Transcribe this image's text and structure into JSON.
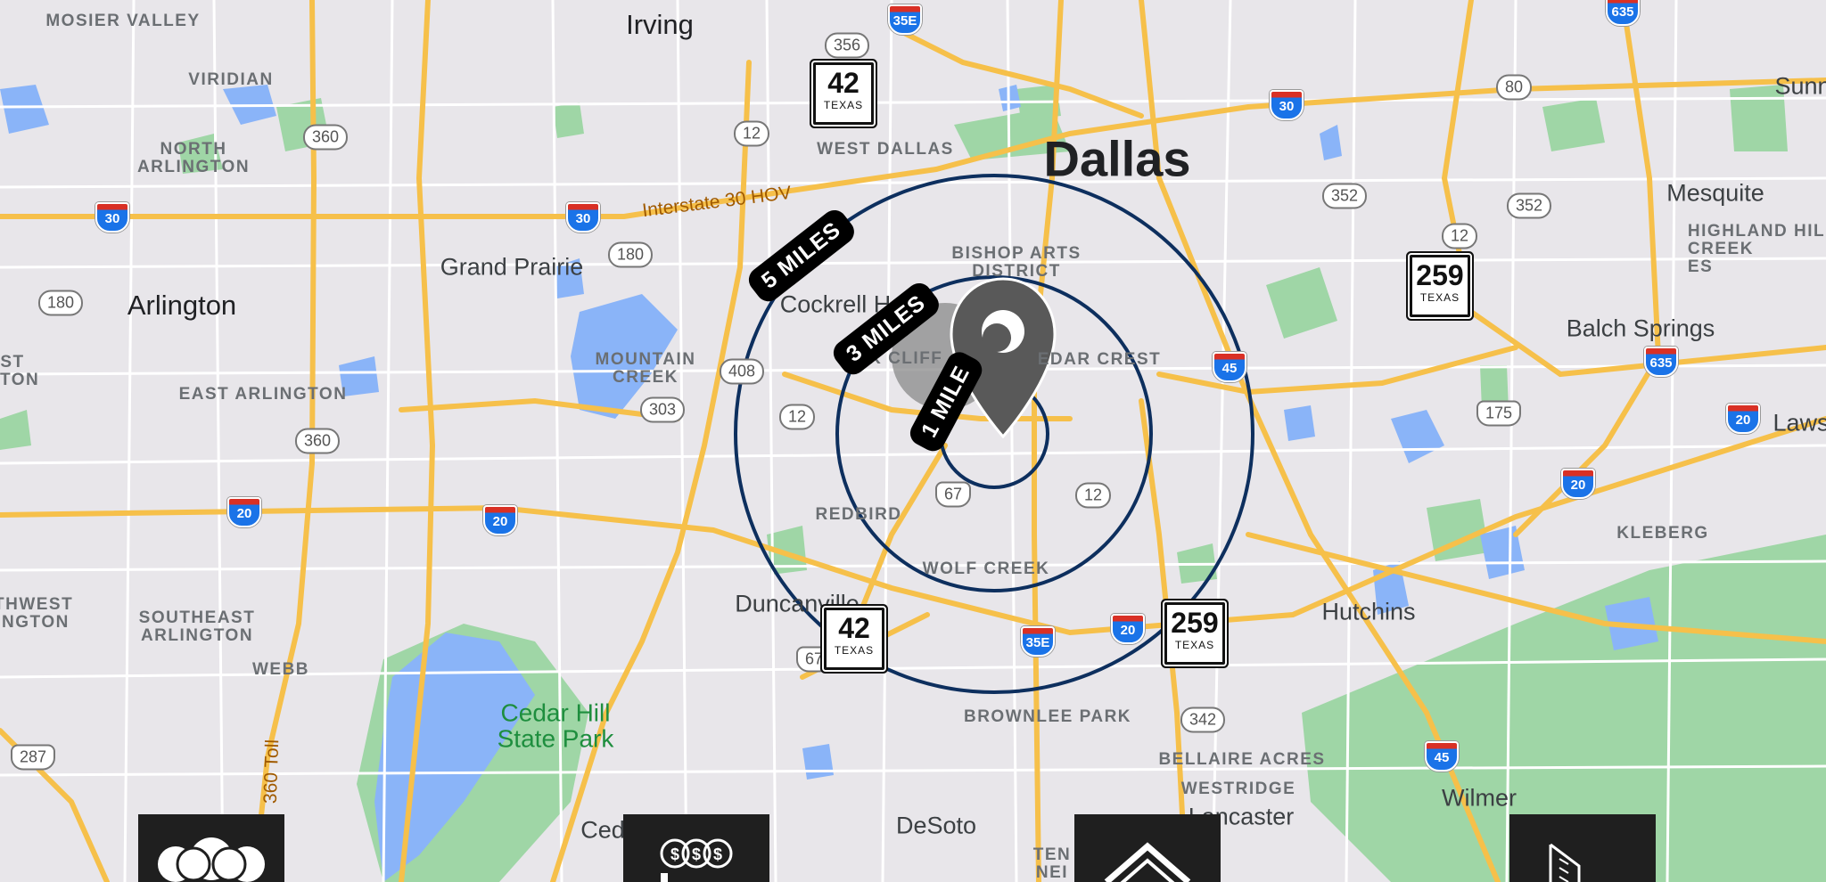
{
  "map": {
    "cities": {
      "dallas": "Dallas",
      "irving": "Irving",
      "arlington": "Arlington",
      "grand_prairie": "Grand Prairie",
      "mesquite": "Mesquite",
      "balch_springs": "Balch Springs",
      "duncanville": "Duncanville",
      "desoto": "DeSoto",
      "hutchins": "Hutchins",
      "wilmer": "Wilmer",
      "lancaster": "Lancaster",
      "cedar_hill_partial": "Ced",
      "sunnyvale_partial": "Sunn",
      "lawson_partial": "Laws",
      "cockrell_hill_partial": "Cockrell H"
    },
    "neighborhoods": {
      "mosier_valley": "MOSIER VALLEY",
      "viridian": "VIRIDIAN",
      "north_arlington": "NORTH\nARLINGTON",
      "east_arlington": "EAST ARLINGTON",
      "southeast_arlington": "SOUTHEAST\nARLINGTON",
      "southwest_arlington_partial": "UTHWEST\nLINGTON",
      "west_arlington_partial": "ST\nGTON",
      "webb": "WEBB",
      "mountain_creek": "MOUNTAIN\nCREEK",
      "west_dallas": "WEST DALLAS",
      "bishop_arts": "BISHOP ARTS\nDISTRICT",
      "oak_cliff_partial": "OAK CLIFF",
      "cedar_crest_partial": "EDAR CREST",
      "redbird": "REDBIRD",
      "wolf_creek": "WOLF CREEK",
      "brownlee_park": "BROWNLEE PARK",
      "bellaire_acres": "BELLAIRE ACRES",
      "westridge": "WESTRIDGE",
      "highland_hills_partial": "HIGHLAND HIL\nCREEK\nES",
      "kleberg": "KLEBERG",
      "tenth_st_partial": "TEN\nNEI"
    },
    "parks": {
      "cedar_hill_state_park": "Cedar Hill\nState Park"
    },
    "roads": {
      "interstate_30_hov": "Interstate 30 HOV",
      "toll_360": "360 Toll"
    },
    "shields": {
      "interstate": [
        "30",
        "30",
        "30",
        "35E",
        "35E",
        "20",
        "20",
        "20",
        "20",
        "20",
        "45",
        "45",
        "635",
        "635"
      ],
      "state": [
        "356",
        "12",
        "360",
        "360",
        "180",
        "180",
        "408",
        "303",
        "12",
        "12",
        "352",
        "352",
        "12",
        "342",
        "80"
      ],
      "us": [
        "67",
        "67",
        "175",
        "287"
      ],
      "texas": [
        {
          "number": "42",
          "state": "TEXAS"
        },
        {
          "number": "42",
          "state": "TEXAS"
        },
        {
          "number": "259",
          "state": "TEXAS"
        },
        {
          "number": "259",
          "state": "TEXAS"
        }
      ]
    },
    "radius_labels": [
      "5 MILES",
      "3 MILES",
      "1 MILE"
    ],
    "colors": {
      "land": "#e8e6ea",
      "water": "#8ab4f8",
      "park": "#9fd6a6",
      "highway": "#f6c04a",
      "ring": "#0d2f5e",
      "pin": "#595959",
      "tile": "#1f1f1f"
    }
  },
  "bottom_tiles": [
    {
      "icon": "people-group-icon"
    },
    {
      "icon": "money-coins-icon"
    },
    {
      "icon": "house-icon"
    },
    {
      "icon": "building-icon"
    }
  ]
}
